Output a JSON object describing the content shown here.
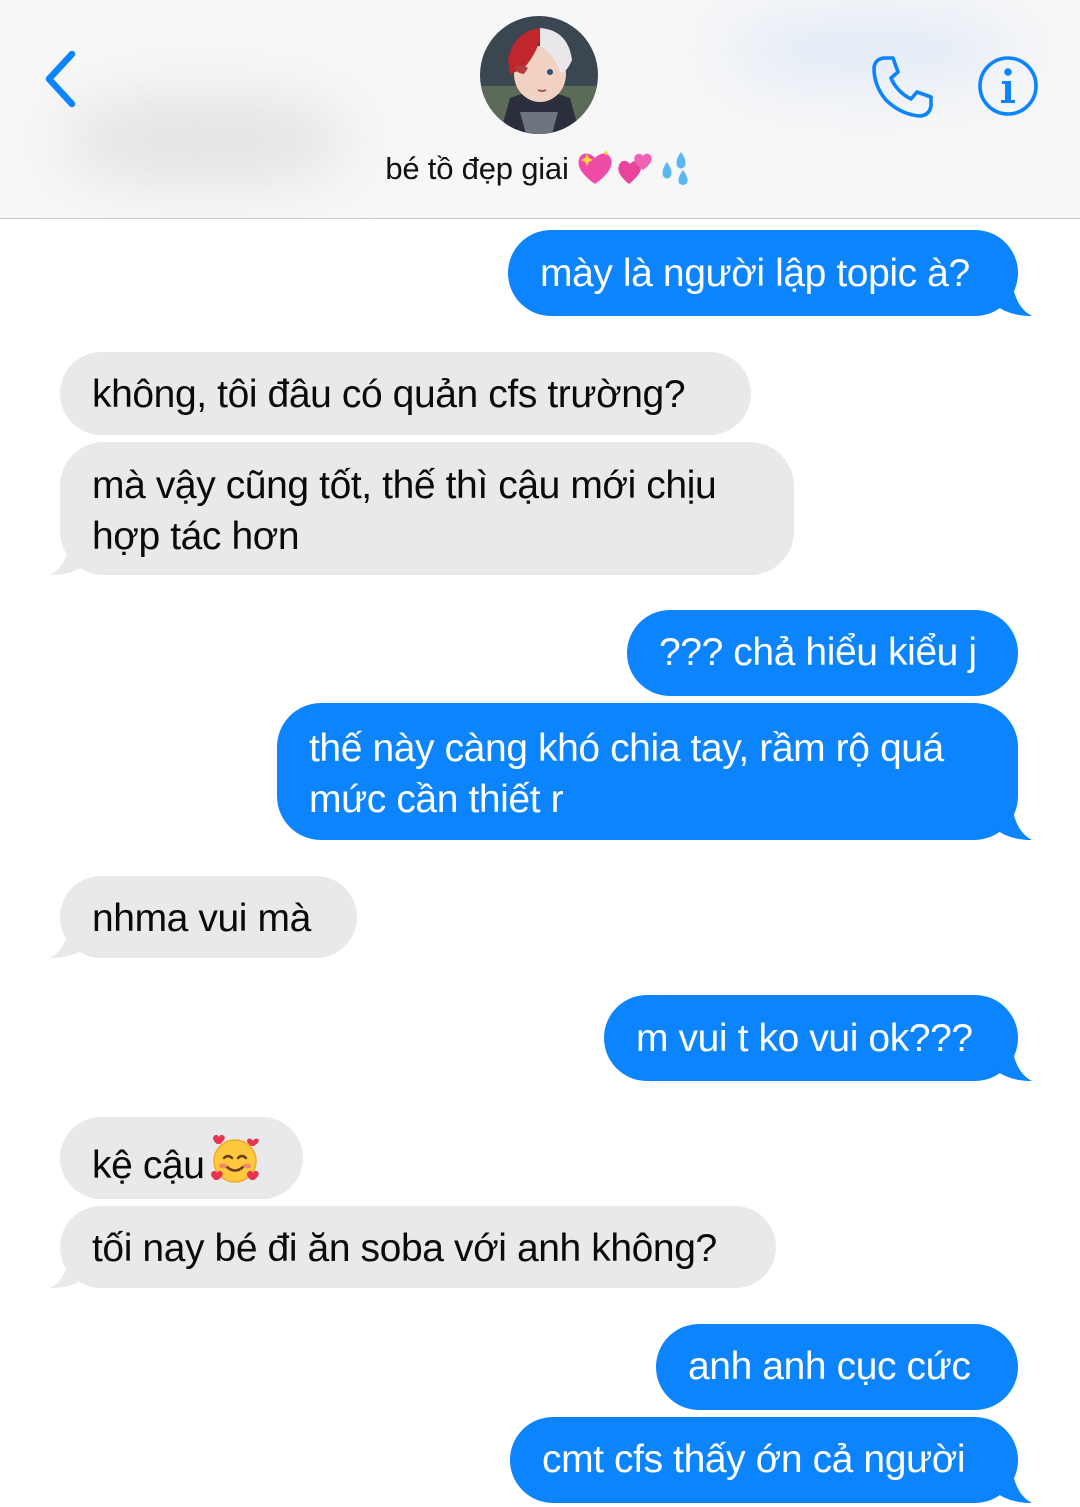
{
  "header": {
    "contact_name": "bé tồ đẹp giai",
    "back_icon": "chevron-left-icon",
    "phone_icon": "phone-icon",
    "info_icon": "info-icon",
    "accent_color": "#0b84fe"
  },
  "messages": [
    {
      "direction": "outgoing",
      "text": "mày là người lập topic à?"
    },
    {
      "direction": "incoming",
      "text": "không, tôi đâu có quản cfs trường?"
    },
    {
      "direction": "incoming",
      "line1": "mà vậy cũng tốt, thế thì cậu mới chịu",
      "line2": "hợp tác hơn"
    },
    {
      "direction": "outgoing",
      "text": "??? chả hiểu kiểu j"
    },
    {
      "direction": "outgoing",
      "line1": "thế này càng khó chia tay, rầm rộ quá",
      "line2": "mức cần thiết r"
    },
    {
      "direction": "incoming",
      "text": "nhma vui mà"
    },
    {
      "direction": "outgoing",
      "text": "m vui t ko vui ok???"
    },
    {
      "direction": "incoming",
      "text": "kệ cậu",
      "emoji": "smiling-face-with-hearts"
    },
    {
      "direction": "incoming",
      "text": "tối nay bé đi ăn soba với anh không?"
    },
    {
      "direction": "outgoing",
      "text": "anh anh cục cức"
    },
    {
      "direction": "outgoing",
      "text": "cmt cfs thấy ớn cả người"
    }
  ],
  "colors": {
    "outgoing_bubble": "#0b84fe",
    "incoming_bubble": "#e9e9eb",
    "header_background": "#f7f7f8"
  }
}
